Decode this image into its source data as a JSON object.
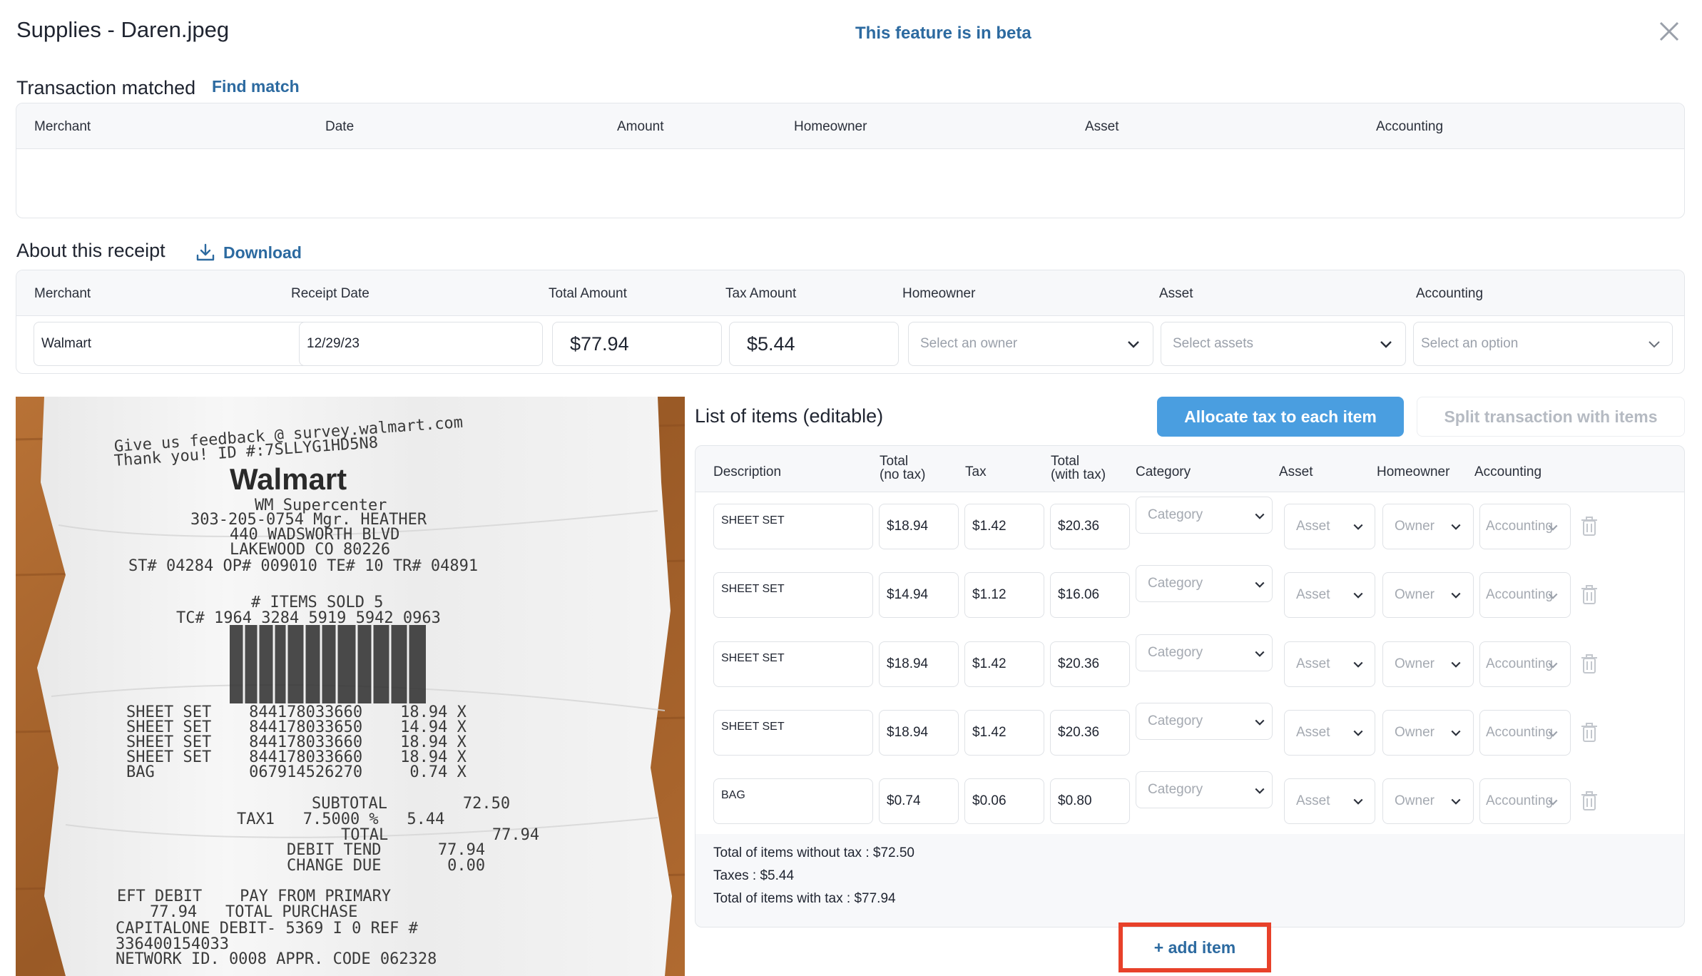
{
  "header": {
    "title": "Supplies - Daren.jpeg",
    "beta_text": "This feature is in beta"
  },
  "transaction": {
    "title": "Transaction matched",
    "find_match": "Find match",
    "columns": [
      "Merchant",
      "Date",
      "Amount",
      "Homeowner",
      "Asset",
      "Accounting"
    ]
  },
  "receipt_info": {
    "title": "About this receipt",
    "download": "Download",
    "columns": [
      "Merchant",
      "Receipt Date",
      "Total Amount",
      "Tax Amount",
      "Homeowner",
      "Asset",
      "Accounting"
    ],
    "merchant": "Walmart",
    "date": "12/29/23",
    "total": "$77.94",
    "tax": "$5.44",
    "homeowner_placeholder": "Select an owner",
    "asset_placeholder": "Select assets",
    "accounting_placeholder": "Select an option"
  },
  "receipt_image": {
    "lines": [
      "Give us feedback @ survey.walmart.com",
      "Thank you! ID #:7SLLYG1HD5N8",
      "Walmart",
      "WM Supercenter",
      "303-205-0754 Mgr. HEATHER",
      "440 WADSWORTH BLVD",
      "LAKEWOOD CO 80226",
      "ST# 04284 OP# 009010 TE# 10 TR# 04891",
      "# ITEMS SOLD 5",
      "TC# 1964 3284 5919 5942 0963",
      "SHEET SET    844178033660    18.94 X",
      "SHEET SET    844178033650    14.94 X",
      "SHEET SET    844178033660    18.94 X",
      "SHEET SET    844178033660    18.94 X",
      "BAG          067914526270     0.74 X",
      "SUBTOTAL        72.50",
      "TAX1   7.5000 %   5.44",
      "TOTAL           77.94",
      "DEBIT TEND      77.94",
      "CHANGE DUE       0.00",
      "EFT DEBIT    PAY FROM PRIMARY",
      "77.94   TOTAL PURCHASE",
      "CAPITALONE DEBIT- 5369 I 0 REF #",
      "336400154033",
      "NETWORK ID. 0008 APPR. CODE 062328"
    ]
  },
  "items": {
    "title": "List of items (editable)",
    "allocate_button": "Allocate tax to each item",
    "split_button": "Split transaction with items",
    "columns": {
      "description": "Description",
      "total_no_tax_1": "Total",
      "total_no_tax_2": "(no tax)",
      "tax": "Tax",
      "total_with_tax_1": "Total",
      "total_with_tax_2": "(with tax)",
      "category": "Category",
      "asset": "Asset",
      "homeowner": "Homeowner",
      "accounting": "Accounting"
    },
    "placeholders": {
      "category": "Category",
      "asset": "Asset",
      "owner": "Owner",
      "accounting": "Accounting"
    },
    "rows": [
      {
        "description": "SHEET SET",
        "total": "$18.94",
        "tax": "$1.42",
        "total_with_tax": "$20.36"
      },
      {
        "description": "SHEET SET",
        "total": "$14.94",
        "tax": "$1.12",
        "total_with_tax": "$16.06"
      },
      {
        "description": "SHEET SET",
        "total": "$18.94",
        "tax": "$1.42",
        "total_with_tax": "$20.36"
      },
      {
        "description": "SHEET SET",
        "total": "$18.94",
        "tax": "$1.42",
        "total_with_tax": "$20.36"
      },
      {
        "description": "BAG",
        "total": "$0.74",
        "tax": "$0.06",
        "total_with_tax": "$0.80"
      }
    ],
    "summary": {
      "without_tax": "Total of items without tax : $72.50",
      "taxes": "Taxes : $5.44",
      "with_tax": "Total of items with tax : $77.94"
    },
    "add_item": "+ add item"
  },
  "colors": {
    "link": "#2c6aa0",
    "primary_button": "#4a9ee0",
    "highlight": "#e8412a",
    "receipt_wood": "#a8642e"
  }
}
